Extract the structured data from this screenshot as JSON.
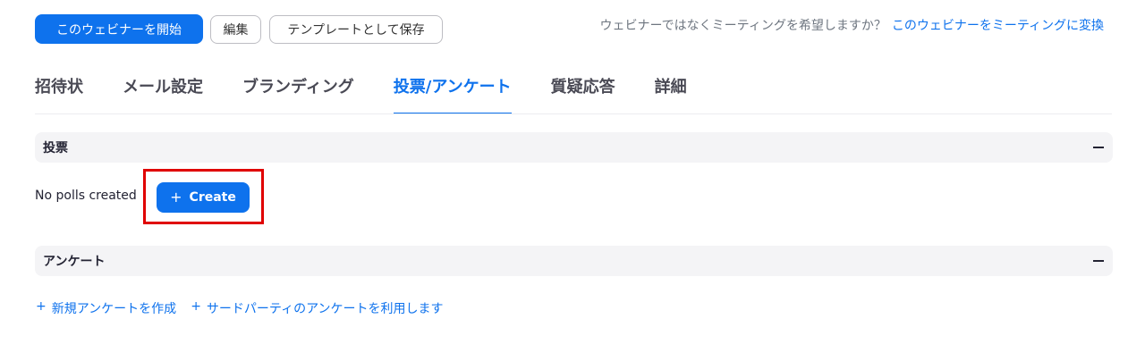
{
  "toolbar": {
    "start_label": "このウェビナーを開始",
    "edit_label": "編集",
    "save_template_label": "テンプレートとして保存",
    "convert_prompt": "ウェビナーではなくミーティングを希望しますか？",
    "convert_link": "このウェビナーをミーティングに変換"
  },
  "tabs": [
    {
      "label": "招待状",
      "active": false
    },
    {
      "label": "メール設定",
      "active": false
    },
    {
      "label": "ブランディング",
      "active": false
    },
    {
      "label": "投票/アンケート",
      "active": true
    },
    {
      "label": "質疑応答",
      "active": false
    },
    {
      "label": "詳細",
      "active": false
    }
  ],
  "polls": {
    "title": "投票",
    "empty_text": "No polls created",
    "create_plus": "+",
    "create_label": "Create"
  },
  "survey": {
    "title": "アンケート",
    "link_plus": "+",
    "new_survey_label": "新規アンケートを作成",
    "third_party_label": "サードパーティのアンケートを利用します"
  },
  "colors": {
    "accent": "#0e72ed",
    "highlight": "#e00000"
  },
  "icons": {
    "collapse": "minus-icon",
    "add": "plus-icon"
  }
}
